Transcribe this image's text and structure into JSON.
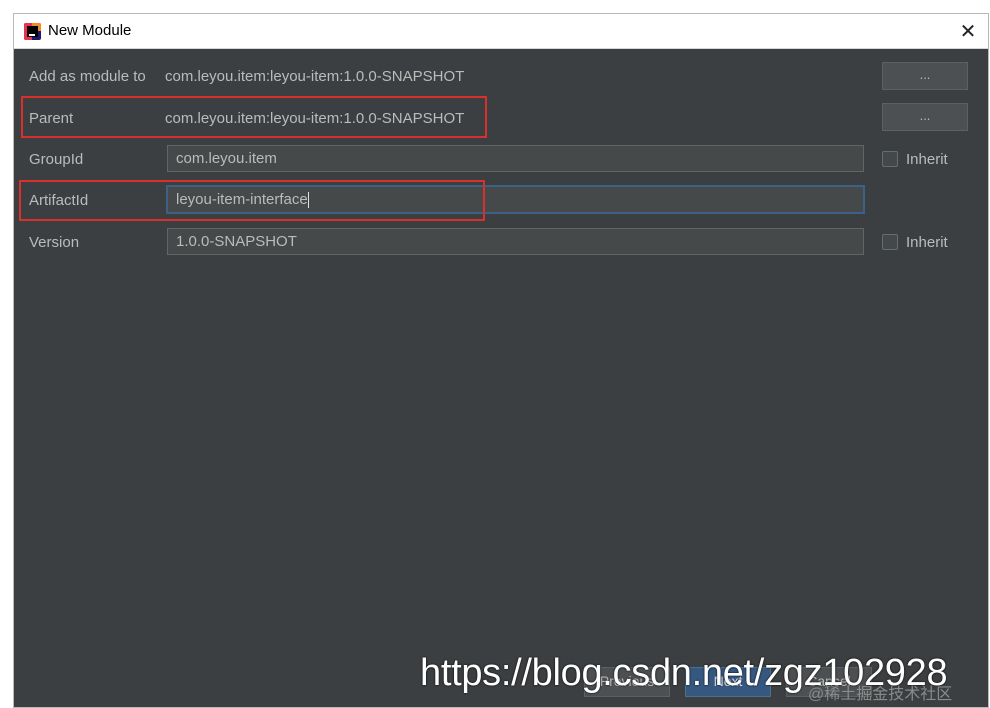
{
  "window": {
    "title": "New Module",
    "close_glyph": "✕"
  },
  "form": {
    "add_as_module_to": {
      "label": "Add as module to",
      "value": "com.leyou.item:leyou-item:1.0.0-SNAPSHOT",
      "button": "..."
    },
    "parent": {
      "label": "Parent",
      "value": "com.leyou.item:leyou-item:1.0.0-SNAPSHOT",
      "button": "..."
    },
    "group_id": {
      "label": "GroupId",
      "value": "com.leyou.item",
      "inherit_label": "Inherit",
      "inherit_checked": false
    },
    "artifact_id": {
      "label": "ArtifactId",
      "value": "leyou-item-interface"
    },
    "version": {
      "label": "Version",
      "value": "1.0.0-SNAPSHOT",
      "inherit_label": "Inherit",
      "inherit_checked": false
    }
  },
  "footer": {
    "previous_label": "Previous",
    "next_label": "Next",
    "cancel_label": "Cancel"
  },
  "overlay": {
    "watermark": "https://blog.csdn.net/zgz102928",
    "watermark_small": "@稀土掘金技术社区"
  },
  "colors": {
    "dialog_bg": "#3c3f41",
    "highlight_red": "#d9302c",
    "focus_blue": "#3d6185"
  }
}
